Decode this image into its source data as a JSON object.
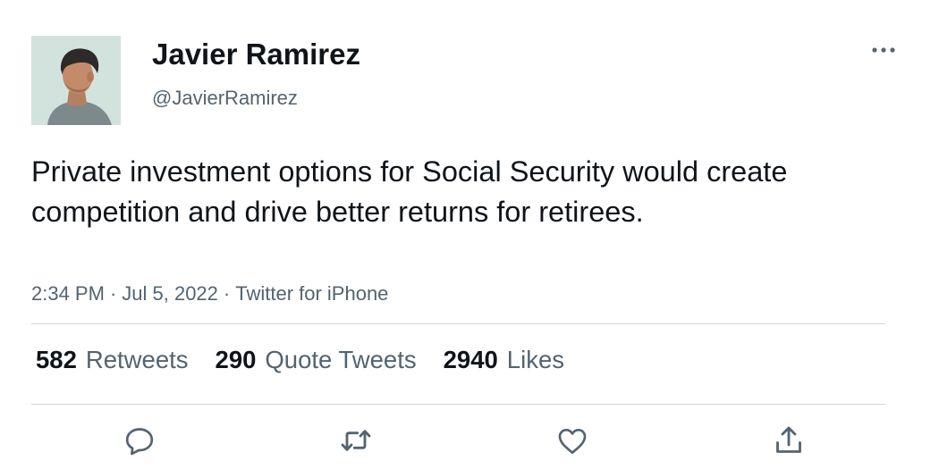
{
  "user": {
    "display_name": "Javier Ramirez",
    "handle": "@JavierRamirez",
    "avatar_icon": "profile-photo"
  },
  "tweet": {
    "text": "Private investment options for Social Security would create competition and drive better returns for retirees.",
    "time": "2:34 PM",
    "date": "Jul 5, 2022",
    "separator": "·",
    "source": "Twitter for iPhone"
  },
  "stats": {
    "retweets": {
      "count": "582",
      "label": "Retweets"
    },
    "quote_tweets": {
      "count": "290",
      "label": "Quote Tweets"
    },
    "likes": {
      "count": "2940",
      "label": "Likes"
    }
  },
  "actions": [
    "reply-icon",
    "retweet-icon",
    "like-icon",
    "share-icon"
  ],
  "colors": {
    "text_primary": "#0f1419",
    "text_secondary": "#536471",
    "divider": "#cfd9de"
  }
}
